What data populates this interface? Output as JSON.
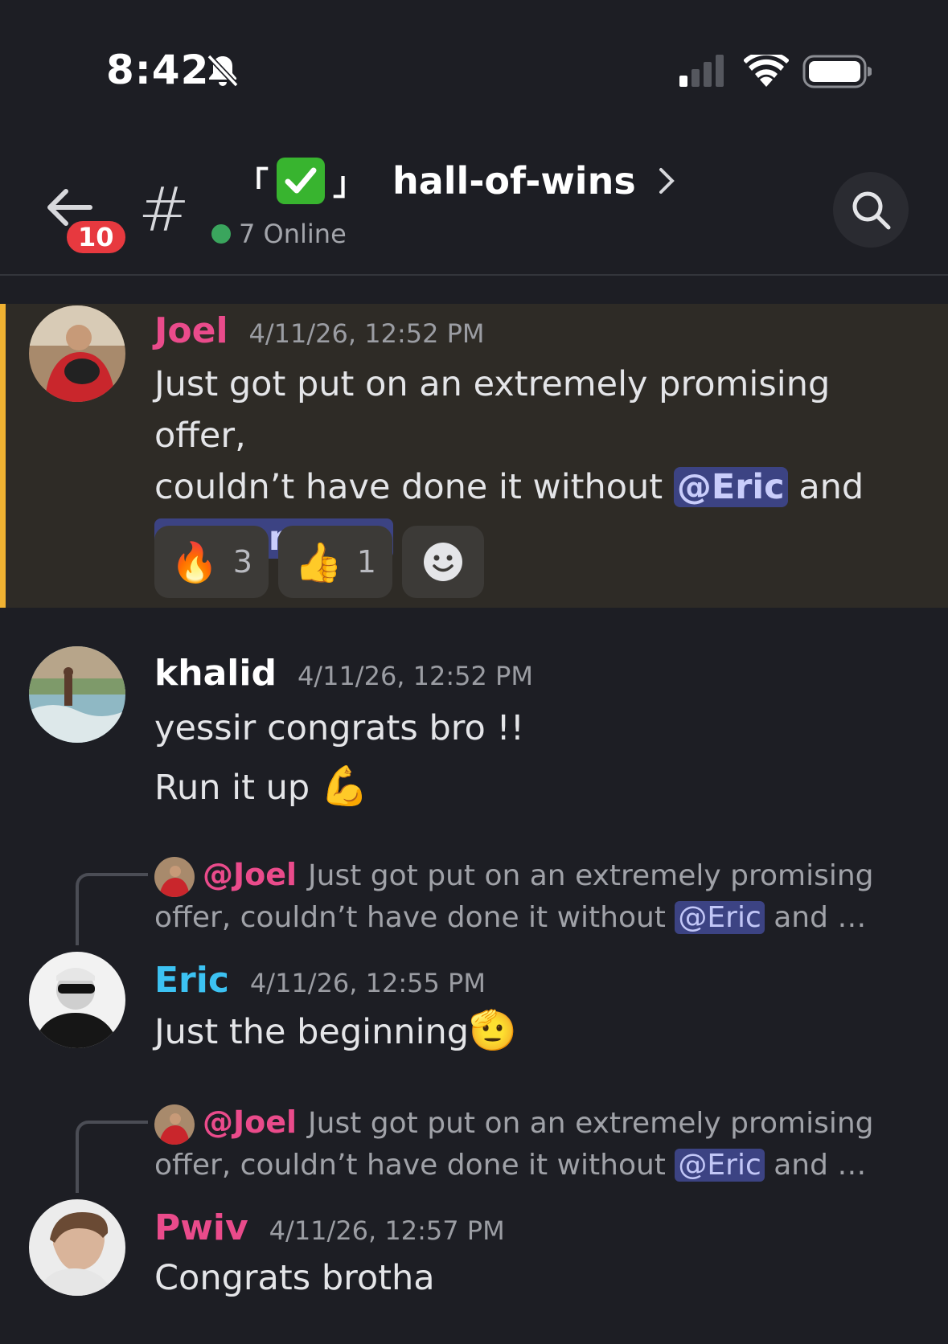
{
  "status_bar": {
    "time": "8:42",
    "icons": [
      "bell-slash-icon",
      "cellular-signal-icon",
      "wifi-icon",
      "battery-icon"
    ]
  },
  "header": {
    "back_badge": "10",
    "channel_prefix": "#",
    "bracket_left": "「",
    "bracket_right": "」",
    "channel_emoji": "✔",
    "channel_name": "hall-of-wins",
    "online_text": "7 Online"
  },
  "messages": [
    {
      "author": "Joel",
      "author_color": "#ea4b8b",
      "timestamp": "4/11/26, 12:52 PM",
      "text_1": "Just got put on an extremely promising offer,",
      "text_2": "couldn’t have done it without",
      "mention_1": "@Eric",
      "text_3": "and",
      "mention_2": "@tommyrax",
      "reactions": [
        {
          "emoji": "🔥",
          "count": "3"
        },
        {
          "emoji": "👍",
          "count": "1"
        }
      ],
      "add_reaction_icon": "add-reaction-smiley-icon"
    },
    {
      "author": "khalid",
      "author_color": "#ffffff",
      "timestamp": "4/11/26, 12:52 PM",
      "line_1": "yessir congrats bro !!",
      "line_2": "Run it up",
      "line_2_emoji": "💪"
    },
    {
      "reply_author": "@Joel",
      "reply_text_1": "Just got put on an extremely promising",
      "reply_text_2": "offer,  couldn’t have done it without",
      "reply_mention": "@Eric",
      "reply_tail": "and …",
      "author": "Eric",
      "author_color": "#3cc2f2",
      "timestamp": "4/11/26, 12:55 PM",
      "text": "Just the beginning",
      "emoji": "🫡"
    },
    {
      "reply_author": "@Joel",
      "reply_text_1": "Just got put on an extremely promising",
      "reply_text_2": "offer,  couldn’t have done it without",
      "reply_mention": "@Eric",
      "reply_tail": "and …",
      "author": "Pwiv",
      "author_color": "#ea4b8b",
      "timestamp": "4/11/26, 12:57 PM",
      "text": "Congrats brotha"
    }
  ]
}
